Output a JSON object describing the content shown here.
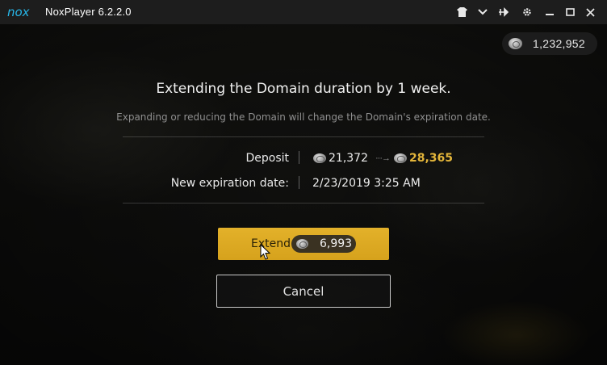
{
  "window": {
    "app_title": "NoxPlayer 6.2.2.0",
    "logo_text": "nox",
    "controls": [
      {
        "name": "home-icon"
      },
      {
        "name": "dropdown-icon"
      },
      {
        "name": "pin-icon"
      },
      {
        "name": "settings-icon"
      },
      {
        "name": "minimize-icon"
      },
      {
        "name": "maximize-icon"
      },
      {
        "name": "close-icon"
      }
    ]
  },
  "balance": {
    "icon": "silver-coin-icon",
    "value": "1,232,952"
  },
  "dialog": {
    "heading": "Extending the Domain duration by 1 week.",
    "subheading": "Expanding or reducing the Domain will change the Domain's expiration date.",
    "deposit_label": "Deposit",
    "deposit_old": "21,372",
    "deposit_arrow": "···→",
    "deposit_new": "28,365",
    "expiration_label": "New expiration date:",
    "expiration_value": "2/23/2019 3:25 AM",
    "extend_label": "Extend",
    "extend_cost": "6,993",
    "cancel_label": "Cancel"
  },
  "colors": {
    "accent_gold": "#d9a520",
    "new_value_gold": "#e3b53a",
    "titlebar": "#1d1d1d"
  }
}
